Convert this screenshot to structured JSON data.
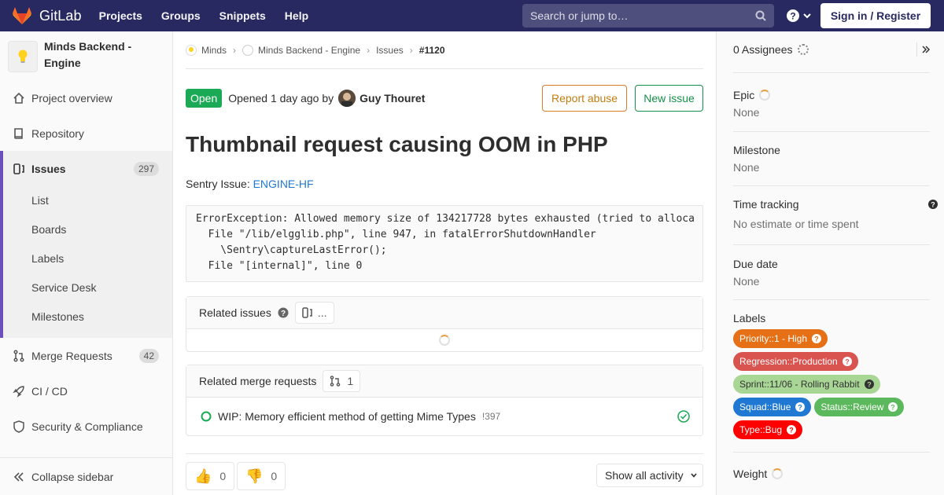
{
  "navbar": {
    "brand": "GitLab",
    "links": [
      "Projects",
      "Groups",
      "Snippets",
      "Help"
    ],
    "search_placeholder": "Search or jump to…",
    "sign_in": "Sign in / Register"
  },
  "sidebar": {
    "project_name": "Minds Backend - Engine",
    "items": {
      "overview": "Project overview",
      "repository": "Repository",
      "issues": "Issues",
      "issues_count": "297",
      "merge_requests": "Merge Requests",
      "mr_count": "42",
      "cicd": "CI / CD",
      "security": "Security & Compliance"
    },
    "sub_items": [
      "List",
      "Boards",
      "Labels",
      "Service Desk",
      "Milestones"
    ],
    "collapse": "Collapse sidebar"
  },
  "breadcrumb": {
    "group": "Minds",
    "project": "Minds Backend - Engine",
    "section": "Issues",
    "current": "#1120"
  },
  "issue": {
    "state": "Open",
    "opened_text": "Opened 1 day ago by",
    "author": "Guy Thouret",
    "report_abuse": "Report abuse",
    "new_issue": "New issue",
    "title": "Thumbnail request causing OOM in PHP",
    "desc_prefix": "Sentry Issue:",
    "desc_link": "ENGINE-HF",
    "code_lines": [
      "ErrorException: Allowed memory size of 134217728 bytes exhausted (tried to alloca",
      "  File \"/lib/elgglib.php\", line 947, in fatalErrorShutdownHandler",
      "    \\Sentry\\captureLastError();",
      "  File \"[internal]\", line 0"
    ]
  },
  "related_issues": {
    "title": "Related issues",
    "chip": "..."
  },
  "related_mrs": {
    "title": "Related merge requests",
    "count": "1",
    "items": [
      {
        "title": "WIP: Memory efficient method of getting Mime Types",
        "ref": "!397"
      }
    ]
  },
  "awards": {
    "thumbs_up": "0",
    "thumbs_down": "0"
  },
  "activity_filter": "Show all activity",
  "right_sidebar": {
    "assignees": "0 Assignees",
    "epic_label": "Epic",
    "epic_value": "None",
    "milestone_label": "Milestone",
    "milestone_value": "None",
    "time_label": "Time tracking",
    "time_value": "No estimate or time spent",
    "due_label": "Due date",
    "due_value": "None",
    "labels_label": "Labels",
    "labels": [
      {
        "text": "Priority::1 - High",
        "color": "#e67015"
      },
      {
        "text": "Regression::Production",
        "color": "#d9534f"
      },
      {
        "text": "Sprint::11/06 - Rolling Rabbit",
        "color": "#a8d695"
      },
      {
        "text": "Squad::Blue",
        "color": "#1f78d1"
      },
      {
        "text": "Status::Review",
        "color": "#5cb85c"
      },
      {
        "text": "Type::Bug",
        "color": "#ff0000"
      }
    ],
    "weight_label": "Weight"
  }
}
